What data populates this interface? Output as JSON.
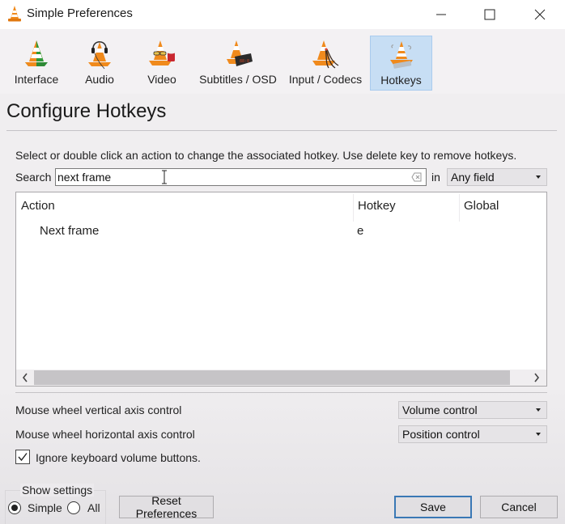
{
  "window": {
    "title": "Simple Preferences",
    "icon": "vlc-cone-icon",
    "controls": [
      "minimize",
      "maximize",
      "close"
    ]
  },
  "toolbar": {
    "items": [
      {
        "label": "Interface",
        "icon": "interface-cone-icon",
        "selected": false
      },
      {
        "label": "Audio",
        "icon": "audio-headphones-cone-icon",
        "selected": false
      },
      {
        "label": "Video",
        "icon": "video-glasses-cone-icon",
        "selected": false
      },
      {
        "label": "Subtitles / OSD",
        "icon": "subtitles-clock-cone-icon",
        "selected": false
      },
      {
        "label": "Input / Codecs",
        "icon": "input-cables-cone-icon",
        "selected": false
      },
      {
        "label": "Hotkeys",
        "icon": "hotkeys-cone-icon",
        "selected": true
      }
    ]
  },
  "page": {
    "title": "Configure Hotkeys",
    "instructions": "Select or double click an action to change the associated hotkey. Use delete key to remove hotkeys."
  },
  "search": {
    "label": "Search",
    "value": "next frame",
    "in_label": "in",
    "field_selected": "Any field"
  },
  "table": {
    "columns": [
      "Action",
      "Hotkey",
      "Global"
    ],
    "rows": [
      {
        "action": "Next frame",
        "hotkey": "e",
        "global": ""
      }
    ]
  },
  "options": {
    "vertical_label": "Mouse wheel vertical axis control",
    "vertical_value": "Volume control",
    "horizontal_label": "Mouse wheel horizontal axis control",
    "horizontal_value": "Position control",
    "ignore_volume_label": "Ignore keyboard volume buttons.",
    "ignore_volume_checked": true
  },
  "footer": {
    "show_settings_label": "Show settings",
    "simple_label": "Simple",
    "all_label": "All",
    "selected_mode": "Simple",
    "reset_label": "Reset Preferences",
    "save_label": "Save",
    "cancel_label": "Cancel"
  },
  "colors": {
    "selected_tab_bg": "#c7def4",
    "default_button_border": "#3a78b5",
    "vlc_orange": "#f08a1c"
  }
}
